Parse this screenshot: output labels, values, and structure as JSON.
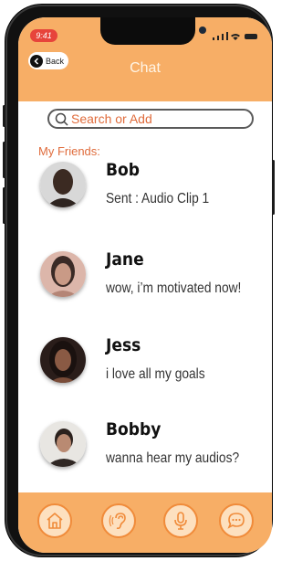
{
  "status_bar": {
    "time": "9:41"
  },
  "header": {
    "back_label": "Back",
    "title": "Chat"
  },
  "search": {
    "placeholder": "Search or Add"
  },
  "friends": {
    "label": "My Friends:",
    "items": [
      {
        "name": "Bob",
        "message": "Sent : Audio Clip 1"
      },
      {
        "name": "Jane",
        "message": "wow, i’m motivated now!"
      },
      {
        "name": "Jess",
        "message": "i love all my goals"
      },
      {
        "name": "Bobby",
        "message": "wanna hear my audios?"
      }
    ]
  },
  "tabbar": {
    "icons": [
      "home-icon",
      "ear-icon",
      "microphone-icon",
      "chat-bubble-icon"
    ]
  },
  "colors": {
    "accent": "#f7ae66",
    "accent_dark": "#f08b3a",
    "text_accent": "#e06c3c",
    "time_pill": "#e7443b"
  }
}
